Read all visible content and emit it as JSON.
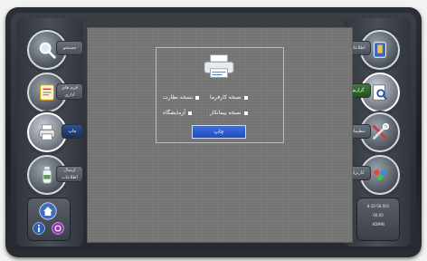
{
  "left_nav": {
    "items": [
      {
        "name": "search",
        "label": "جستجو",
        "icon": "magnifier-icon"
      },
      {
        "name": "forms",
        "label": "فرم های اداری",
        "icon": "forms-icon"
      },
      {
        "name": "print",
        "label": "چاپ",
        "icon": "printer-icon",
        "active": true
      },
      {
        "name": "transfer",
        "label": "ارسال اطلاعات",
        "icon": "bottle-icon"
      }
    ],
    "home_box": {
      "home_icon": "home-icon",
      "info_icon": "info-icon",
      "power_icon": "power-icon"
    }
  },
  "right_nav": {
    "items": [
      {
        "name": "intro",
        "label": "اطلاعات",
        "icon": "book-icon"
      },
      {
        "name": "report",
        "label": "گزارش",
        "icon": "document-search-icon",
        "active": true
      },
      {
        "name": "tools",
        "label": "تنظیمات",
        "icon": "tools-icon"
      },
      {
        "name": "users",
        "label": "کاربران",
        "icon": "users-icon"
      }
    ],
    "info_box": {
      "line1": "8-10-58 001",
      "line2": "00:00",
      "line3": "ADMIN"
    }
  },
  "dialog": {
    "printer_icon": "printer-icon",
    "options": [
      {
        "label": "نسخه کارفرما"
      },
      {
        "label": "نسخه نظارت"
      },
      {
        "label": "نسخه پیمانکار"
      },
      {
        "label": "آزمایشگاه"
      }
    ],
    "print_button": "چاپ"
  },
  "colors": {
    "background": "#7a7a7a",
    "accent_blue": "#2f5fd0",
    "accent_green": "#3e7a3b"
  }
}
